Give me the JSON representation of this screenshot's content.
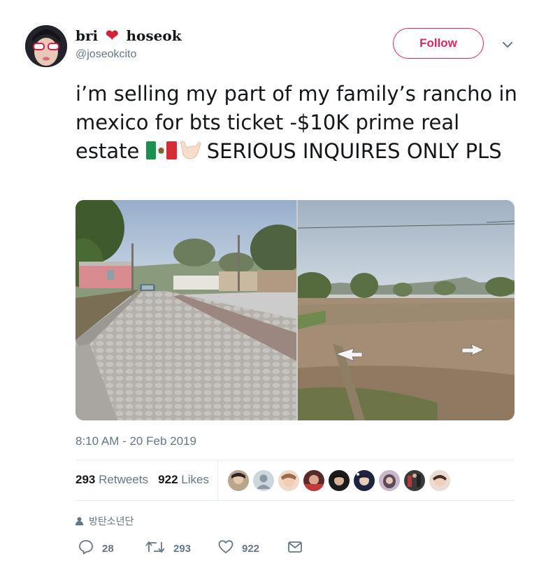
{
  "user": {
    "display_name_first": "bri",
    "display_name_last": "hoseok",
    "handle": "@joseokcito"
  },
  "follow_label": "Follow",
  "tweet": {
    "text_1": "i’m selling my part of my family’s rancho in mexico for bts ticket -$10K  prime real estate ",
    "text_2": "  SERIOUS INQUIRES ONLY PLS",
    "emojis": [
      "mexico-flag-icon",
      "call-me-hand-icon"
    ]
  },
  "timestamp": "8:10 AM - 20 Feb 2019",
  "stats": {
    "retweets_count": "293",
    "retweets_label": "Retweets",
    "likes_count": "922",
    "likes_label": "Likes"
  },
  "source_label": "방탄소년단",
  "actions": {
    "reply_count": "28",
    "retweet_count": "293",
    "like_count": "922"
  },
  "colors": {
    "accent": "#e0245e",
    "muted": "#657786",
    "text": "#14171a",
    "heart": "#d3233a"
  }
}
